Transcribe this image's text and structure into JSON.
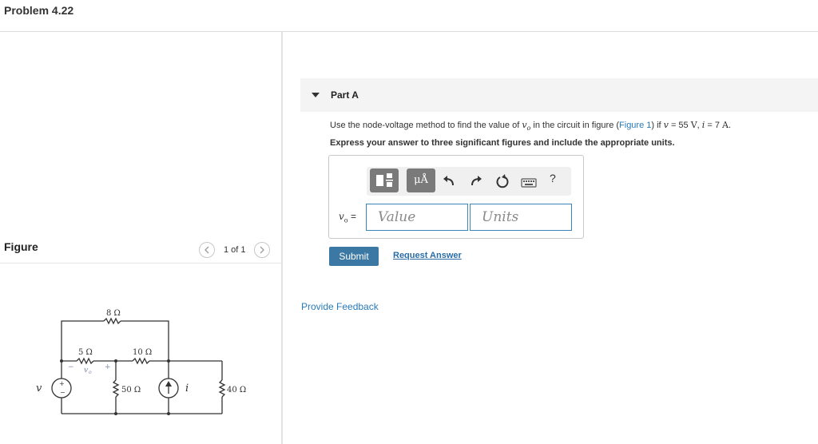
{
  "header": {
    "title": "Problem 4.22"
  },
  "figure_panel": {
    "label": "Figure",
    "pager": "1 of 1",
    "prev_icon": "chevron-left-icon",
    "next_icon": "chevron-right-icon",
    "circuit": {
      "r_top": "8 Ω",
      "r_left": "5 Ω",
      "r_mid": "10 Ω",
      "r_vert": "50 Ω",
      "r_right": "40 Ω",
      "vo_label": "v",
      "vo_sub": "o",
      "source_v": "v",
      "source_i": "i",
      "plus": "+",
      "minus": "−"
    }
  },
  "part_a": {
    "title": "Part A",
    "question": {
      "prefix": "Use the node-voltage method to find the value of ",
      "var_vo": "v",
      "var_vo_sub": "o",
      "mid": " in the circuit in figure (",
      "link": "Figure 1",
      "post": ") if ",
      "var_v": "v",
      "eq1": " = 55 ",
      "unit_v": "V",
      "comma": ", ",
      "var_i": "i",
      "eq2": " = 7 ",
      "unit_a": "A",
      "end": "."
    },
    "instruction": "Express your answer to three significant figures and include the appropriate units.",
    "toolbar": {
      "template_icon": "templates-icon",
      "units_label": "μÅ",
      "undo_icon": "undo-icon",
      "redo_icon": "redo-icon",
      "reset_icon": "reset-icon",
      "keyboard_icon": "keyboard-icon",
      "help_label": "?"
    },
    "answer_label_var": "v",
    "answer_label_sub": "o",
    "answer_label_eq": " =",
    "value_placeholder": "Value",
    "units_placeholder": "Units",
    "submit_label": "Submit",
    "request_answer_label": "Request Answer"
  },
  "feedback_label": "Provide Feedback",
  "colors": {
    "link": "#2a7ab8",
    "submit": "#3b78a3",
    "input_border": "#3a84b8"
  }
}
